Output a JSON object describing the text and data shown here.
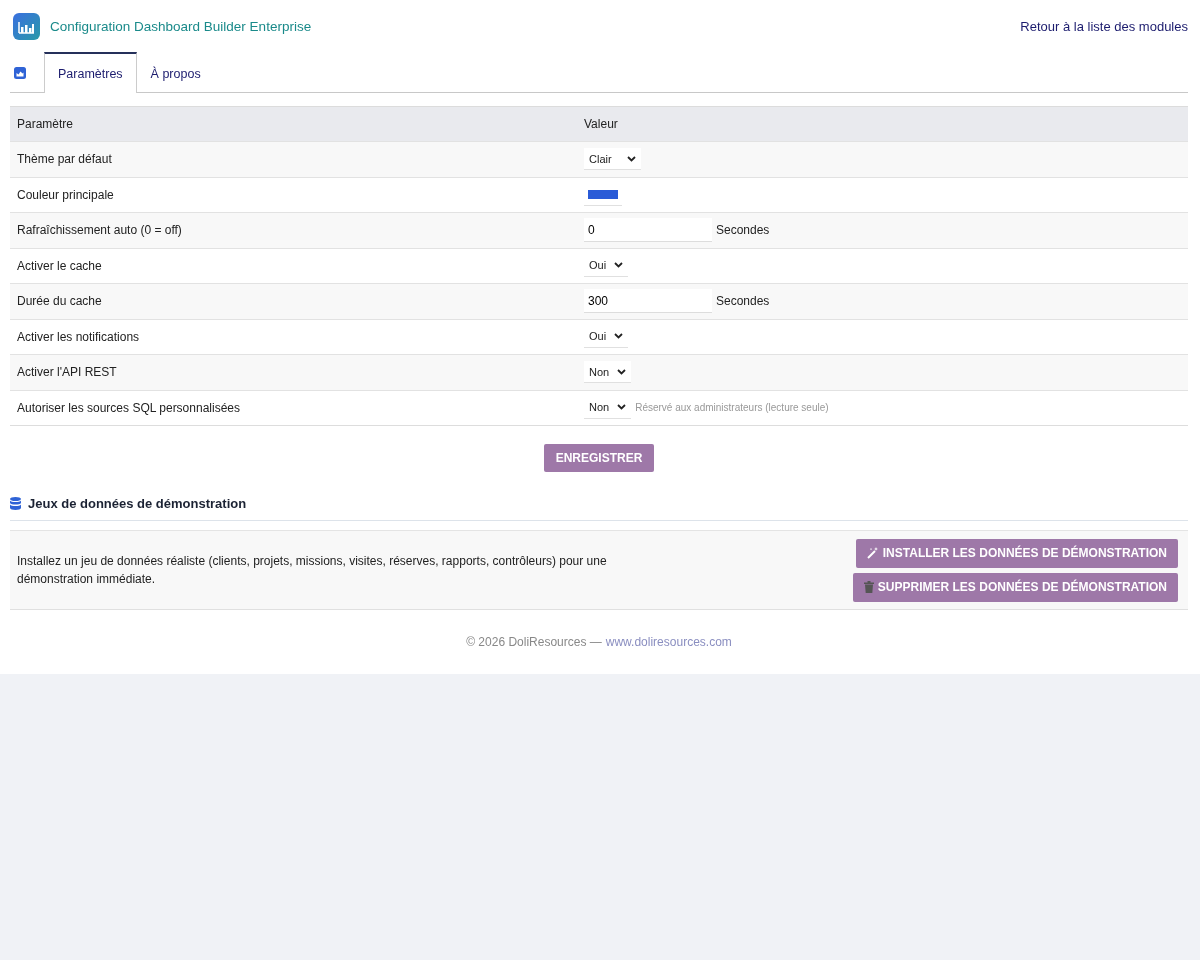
{
  "header": {
    "title": "Configuration Dashboard Builder Enterprise",
    "back_link": "Retour à la liste des modules"
  },
  "tabs": [
    {
      "label": "Paramètres",
      "selected": true
    },
    {
      "label": "À propos",
      "selected": false
    }
  ],
  "settings_table": {
    "columns": [
      "Paramètre",
      "Valeur"
    ],
    "rows": [
      {
        "label": "Thème par défaut",
        "kind": "select",
        "value": "Clair"
      },
      {
        "label": "Couleur principale",
        "kind": "color",
        "color": "#2a5bd7"
      },
      {
        "label": "Rafraîchissement auto (0 = off)",
        "kind": "number",
        "value": "0",
        "unit": "Secondes"
      },
      {
        "label": "Activer le cache",
        "kind": "select",
        "value": "Oui"
      },
      {
        "label": "Durée du cache",
        "kind": "number",
        "value": "300",
        "unit": "Secondes"
      },
      {
        "label": "Activer les notifications",
        "kind": "select",
        "value": "Oui"
      },
      {
        "label": "Activer l'API REST",
        "kind": "select",
        "value": "Non"
      },
      {
        "label": "Autoriser les sources SQL personnalisées",
        "kind": "select",
        "value": "Non",
        "note": "Réservé aux administrateurs (lecture seule)"
      }
    ]
  },
  "save_button": "ENREGISTRER",
  "demo_section": {
    "title": "Jeux de données de démonstration",
    "description": "Installez un jeu de données réaliste (clients, projets, missions, visites, réserves, rapports, contrôleurs) pour une démonstration immédiate.",
    "buttons": [
      {
        "kind": "install",
        "label": "INSTALLER LES DONNÉES DE DÉMONSTRATION"
      },
      {
        "kind": "delete",
        "label": "SUPPRIMER LES DONNÉES DE DÉMONSTRATION"
      }
    ]
  },
  "footer": {
    "copyright": "© 2026 DoliResources —",
    "link": "www.doliresources.com"
  }
}
